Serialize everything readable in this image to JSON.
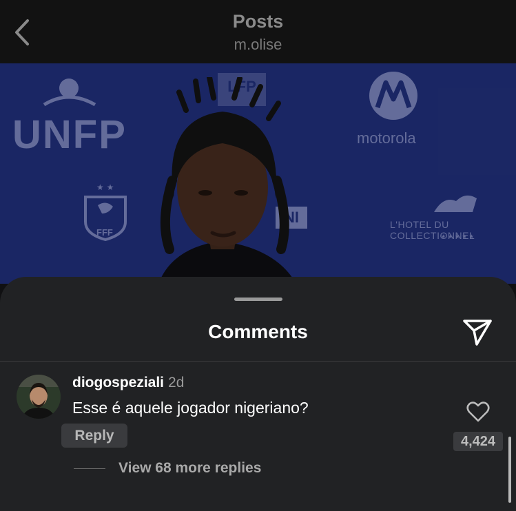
{
  "header": {
    "title": "Posts",
    "subtitle": "m.olise"
  },
  "photo": {
    "logos": [
      "UNFP",
      "motorola",
      "L'HOTEL DU COLLECTIONNEL",
      "LFP",
      "FFF",
      "NI"
    ],
    "stars": "★★★★★"
  },
  "comments_sheet": {
    "title": "Comments",
    "comment": {
      "username": "diogospeziali",
      "time": "2d",
      "text": "Esse é aquele jogador nigeriano?",
      "reply_label": "Reply",
      "likes": "4,424",
      "view_replies_label": "View 68 more replies"
    }
  },
  "colors": {
    "background": "#101012",
    "sheet": "#212224",
    "photo_backdrop": "#1d2a6d"
  }
}
